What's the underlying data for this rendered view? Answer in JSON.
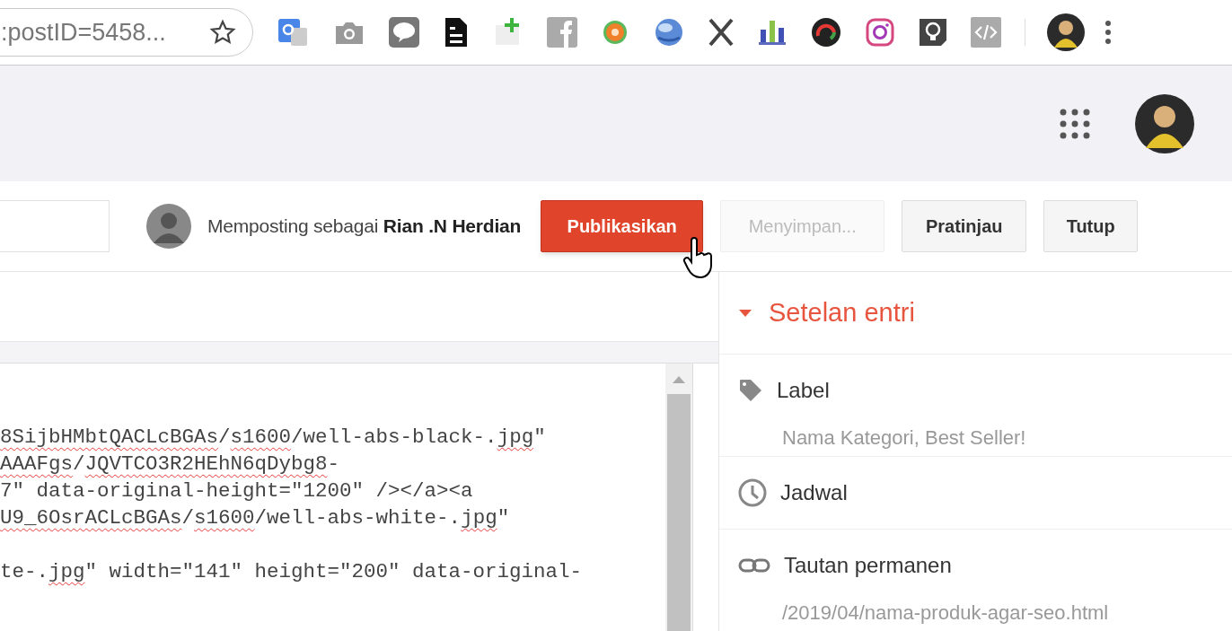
{
  "browser": {
    "address": ":postID=5458..."
  },
  "action_bar": {
    "posting_as": "Memposting sebagai",
    "author": "Rian .N Herdian",
    "buttons": [
      {
        "label": "Publikasikan",
        "kind": "primary",
        "disabled": false
      },
      {
        "label": "Menyimpan...",
        "kind": "default",
        "disabled": true
      },
      {
        "label": "Pratinjau",
        "kind": "default",
        "disabled": false
      },
      {
        "label": "Tutup",
        "kind": "default",
        "disabled": false
      }
    ]
  },
  "editor": {
    "lines": [
      {
        "blank_line_before": false,
        "segments": [
          {
            "text": "8SijbHMbtQACLcBGAs",
            "misspelled": true
          },
          {
            "text": "/",
            "misspelled": false
          },
          {
            "text": "s1600",
            "misspelled": true
          },
          {
            "text": "/well-abs-black-.",
            "misspelled": false
          },
          {
            "text": "jpg",
            "misspelled": true
          },
          {
            "text": "\"",
            "misspelled": false
          }
        ]
      },
      {
        "blank_line_before": false,
        "segments": [
          {
            "text": "AAAFgs",
            "misspelled": true
          },
          {
            "text": "/",
            "misspelled": false
          },
          {
            "text": "JQVTCO3R2HEhN6qDybg8",
            "misspelled": true
          },
          {
            "text": "-",
            "misspelled": false
          }
        ]
      },
      {
        "blank_line_before": false,
        "segments": [
          {
            "text": "7\" data-original-height=\"1200\" /></a><a",
            "misspelled": false
          }
        ]
      },
      {
        "blank_line_before": false,
        "segments": [
          {
            "text": "U9_6OsrACLcBGAs",
            "misspelled": true
          },
          {
            "text": "/",
            "misspelled": false
          },
          {
            "text": "s1600",
            "misspelled": true
          },
          {
            "text": "/well-abs-white-.",
            "misspelled": false
          },
          {
            "text": "jpg",
            "misspelled": true
          },
          {
            "text": "\"",
            "misspelled": false
          }
        ]
      },
      {
        "blank_line_before": true,
        "segments": [
          {
            "text": "te-.",
            "misspelled": false
          },
          {
            "text": "jpg",
            "misspelled": true
          },
          {
            "text": "\" width=\"141\" height=\"200\" data-original-",
            "misspelled": false
          }
        ]
      }
    ]
  },
  "settings": {
    "title": "Setelan entri",
    "expanded": true,
    "sections": [
      {
        "kind": "label",
        "title": "Label",
        "value": "Nama Kategori, Best Seller!"
      },
      {
        "kind": "schedule",
        "title": "Jadwal"
      },
      {
        "kind": "permalink",
        "title": "Tautan permanen",
        "value": "/2019/04/nama-produk-agar-seo.html"
      }
    ]
  }
}
